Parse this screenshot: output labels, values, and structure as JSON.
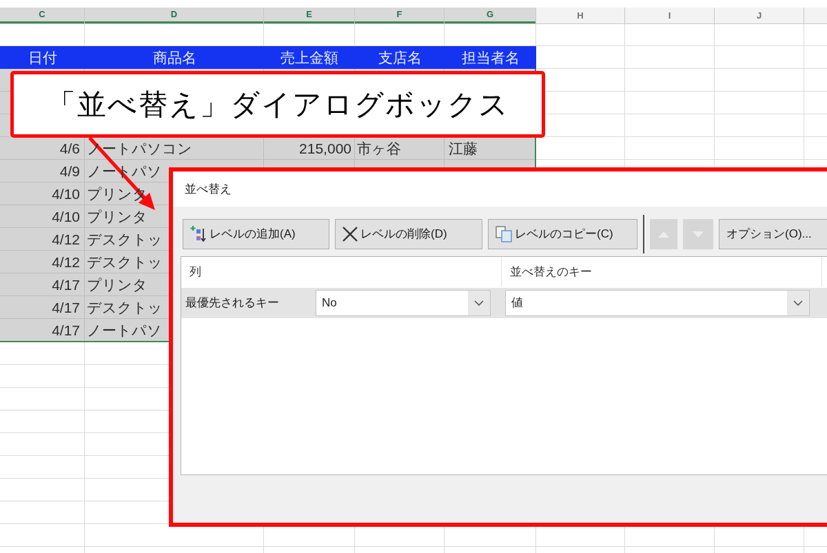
{
  "spreadsheet": {
    "columns": [
      {
        "label": "C",
        "selected": true
      },
      {
        "label": "D",
        "selected": true
      },
      {
        "label": "E",
        "selected": true
      },
      {
        "label": "F",
        "selected": true
      },
      {
        "label": "G",
        "selected": true
      },
      {
        "label": "H",
        "selected": false
      },
      {
        "label": "I",
        "selected": false
      },
      {
        "label": "J",
        "selected": false
      }
    ],
    "header_row": [
      "日付",
      "商品名",
      "売上金額",
      "支店名",
      "担当者名"
    ],
    "rows": [
      {
        "cells": [
          "4/6",
          "ノートパソコン",
          "215,000",
          "市ヶ谷",
          "江藤"
        ]
      },
      {
        "cells": [
          "4/9",
          "ノートパソ"
        ]
      },
      {
        "cells": [
          "4/10",
          "プリンタ"
        ]
      },
      {
        "cells": [
          "4/10",
          "プリンタ"
        ]
      },
      {
        "cells": [
          "4/12",
          "デスクトッ"
        ]
      },
      {
        "cells": [
          "4/12",
          "デスクトッ"
        ]
      },
      {
        "cells": [
          "4/17",
          "プリンタ"
        ]
      },
      {
        "cells": [
          "4/17",
          "デスクトッ"
        ]
      },
      {
        "cells": [
          "4/17",
          "ノートパソ"
        ]
      }
    ]
  },
  "callout": {
    "text": "「並べ替え」ダイアログボックス"
  },
  "dialog": {
    "title": "並べ替え",
    "toolbar": [
      {
        "kind": "add",
        "label": "レベルの追加(A)",
        "disabled": false
      },
      {
        "kind": "delete",
        "label": "レベルの削除(D)",
        "disabled": false
      },
      {
        "kind": "copy",
        "label": "レベルのコピー(C)",
        "disabled": false
      },
      {
        "kind": "separator"
      },
      {
        "kind": "move-up",
        "disabled": true
      },
      {
        "kind": "move-down",
        "disabled": true
      },
      {
        "kind": "options",
        "label": "オプション(O)...",
        "disabled": false
      }
    ],
    "level_list": {
      "headers": [
        "列",
        "並べ替えのキー"
      ],
      "rows": [
        {
          "label": "最優先されるキー",
          "column": "No",
          "sort_on": "値",
          "selected": true
        }
      ]
    }
  }
}
